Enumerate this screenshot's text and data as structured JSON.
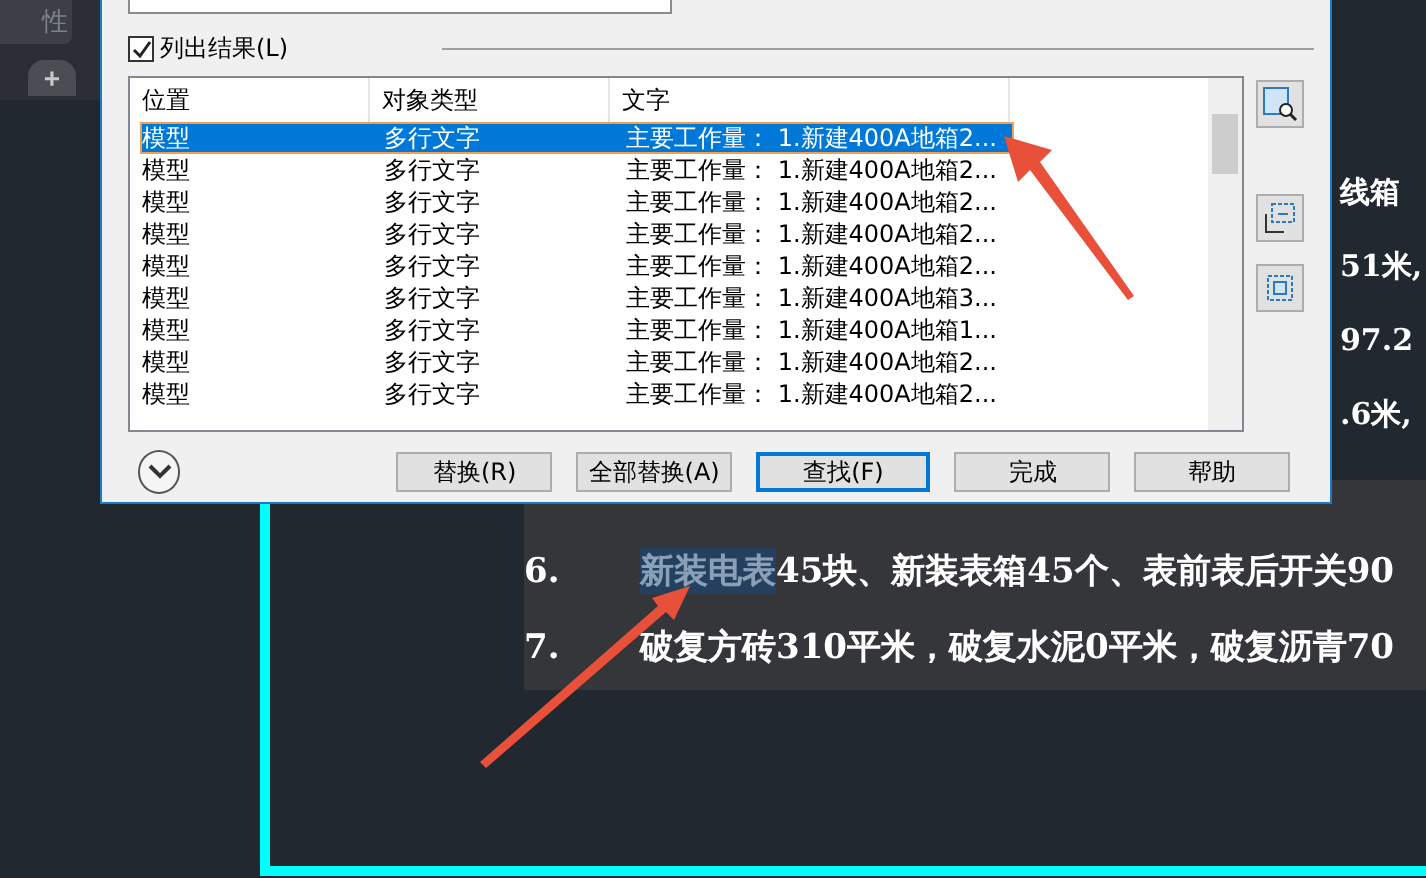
{
  "document_tab": {
    "label": "性"
  },
  "new_tab_button": "+",
  "dialog": {
    "list_results": {
      "label": "列出结果(L)",
      "checked": true
    },
    "columns": [
      "位置",
      "对象类型",
      "文字"
    ],
    "rows": [
      {
        "location": "模型",
        "type": "多行文字",
        "text": "主要工作量： 1.新建400A地箱2...",
        "selected": true
      },
      {
        "location": "模型",
        "type": "多行文字",
        "text": "主要工作量： 1.新建400A地箱2...",
        "selected": false
      },
      {
        "location": "模型",
        "type": "多行文字",
        "text": "主要工作量： 1.新建400A地箱2...",
        "selected": false
      },
      {
        "location": "模型",
        "type": "多行文字",
        "text": "主要工作量： 1.新建400A地箱2...",
        "selected": false
      },
      {
        "location": "模型",
        "type": "多行文字",
        "text": "主要工作量： 1.新建400A地箱2...",
        "selected": false
      },
      {
        "location": "模型",
        "type": "多行文字",
        "text": "主要工作量： 1.新建400A地箱3...",
        "selected": false
      },
      {
        "location": "模型",
        "type": "多行文字",
        "text": "主要工作量： 1.新建400A地箱1...",
        "selected": false
      },
      {
        "location": "模型",
        "type": "多行文字",
        "text": "主要工作量： 1.新建400A地箱2...",
        "selected": false
      },
      {
        "location": "模型",
        "type": "多行文字",
        "text": "主要工作量： 1.新建400A地箱2...",
        "selected": false
      }
    ],
    "buttons": [
      {
        "label": "替换(R)",
        "default": false
      },
      {
        "label": "全部替换(A)",
        "default": false
      },
      {
        "label": "查找(F)",
        "default": true
      },
      {
        "label": "完成",
        "default": false
      },
      {
        "label": "帮助",
        "default": false
      }
    ]
  },
  "drawing": {
    "edge_texts": [
      "线箱",
      "51米,",
      "97.2",
      ".6米,"
    ],
    "lines": [
      {
        "number": "6.",
        "highlight": "新装电表",
        "text": "45块、新装表箱45个、表前表后开关90"
      },
      {
        "number": "7.",
        "text": "破复方砖310平米，破复水泥0平米，破复沥青70"
      }
    ]
  }
}
